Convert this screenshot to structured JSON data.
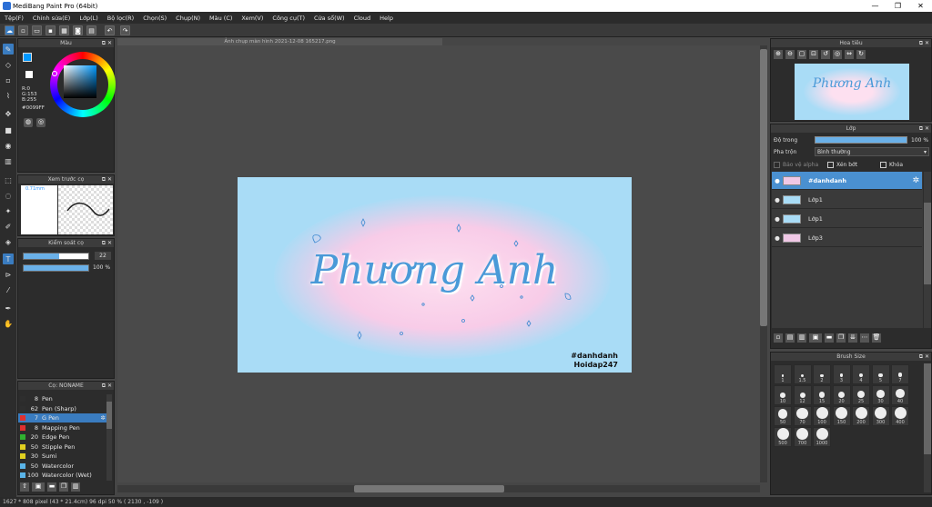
{
  "window": {
    "title": "MediBang Paint Pro (64bit)",
    "min": "—",
    "max": "❐",
    "close": "✕"
  },
  "menu": [
    "Tệp(F)",
    "Chỉnh sửa(E)",
    "Lớp(L)",
    "Bộ lọc(R)",
    "Chọn(S)",
    "Chụp(N)",
    "Màu (C)",
    "Xem(V)",
    "Công cụ(T)",
    "Cửa sổ(W)",
    "Cloud",
    "Help"
  ],
  "color_panel": {
    "title": "Màu",
    "r": "R:0",
    "g": "G:153",
    "b": "B:255",
    "hex": "#0099FF",
    "accent": "#0099FF"
  },
  "preview_panel": {
    "title": "Xem trước cọ",
    "size": "0.71mm"
  },
  "brush_control": {
    "title": "Kiểm soát cọ",
    "size": "22",
    "opacity": "100 %",
    "size_fraction": 0.55,
    "opacity_fraction": 1.0
  },
  "brush_panel": {
    "title": "Cọ: NONAME",
    "items": [
      {
        "size": "8",
        "name": "Pen",
        "color": "#2e2e2e"
      },
      {
        "size": "62",
        "name": "Pen (Sharp)",
        "color": "#2e2e2e"
      },
      {
        "size": "7",
        "name": "G Pen",
        "color": "#e03030"
      },
      {
        "size": "8",
        "name": "Mapping Pen",
        "color": "#e03030"
      },
      {
        "size": "20",
        "name": "Edge Pen",
        "color": "#30b030"
      },
      {
        "size": "50",
        "name": "Stipple Pen",
        "color": "#e0d020"
      },
      {
        "size": "30",
        "name": "Sumi",
        "color": "#e0d020"
      },
      {
        "size": "50",
        "name": "Watercolor",
        "color": "#5ab4e8"
      },
      {
        "size": "100",
        "name": "Watercolor (Wet)",
        "color": "#5ab4e8"
      }
    ]
  },
  "document": {
    "tab": "Ảnh chụp màn hình 2021-12-08 165217.png",
    "art_text": "Phương Anh",
    "watermark1": "#danhdanh",
    "watermark2": "Hoidap247"
  },
  "navigator": {
    "title": "Hoa tiêu"
  },
  "layers": {
    "title": "Lớp",
    "opacity_label": "Độ trong",
    "opacity_value": "100 %",
    "blend_label": "Pha trộn",
    "blend_value": "Bình thường",
    "protect_alpha": "Bảo vệ alpha",
    "clip": "Xén bớt",
    "lock": "Khóa",
    "items": [
      {
        "name": "#danhdanh",
        "selected": true
      },
      {
        "name": "Lớp1",
        "selected": false
      },
      {
        "name": "Lớp1",
        "selected": false
      },
      {
        "name": "Lớp3",
        "selected": false
      }
    ]
  },
  "brush_size": {
    "title": "Brush Size",
    "sizes": [
      "1",
      "1.5",
      "2",
      "3",
      "4",
      "5",
      "7",
      "10",
      "12",
      "15",
      "20",
      "25",
      "30",
      "40",
      "50",
      "70",
      "100",
      "150",
      "200",
      "300",
      "400",
      "500",
      "700",
      "1000"
    ]
  },
  "status": "1627 * 808 pixel   (43 * 21.4cm)   96 dpi   50 %   ( 2130 , -109 )"
}
